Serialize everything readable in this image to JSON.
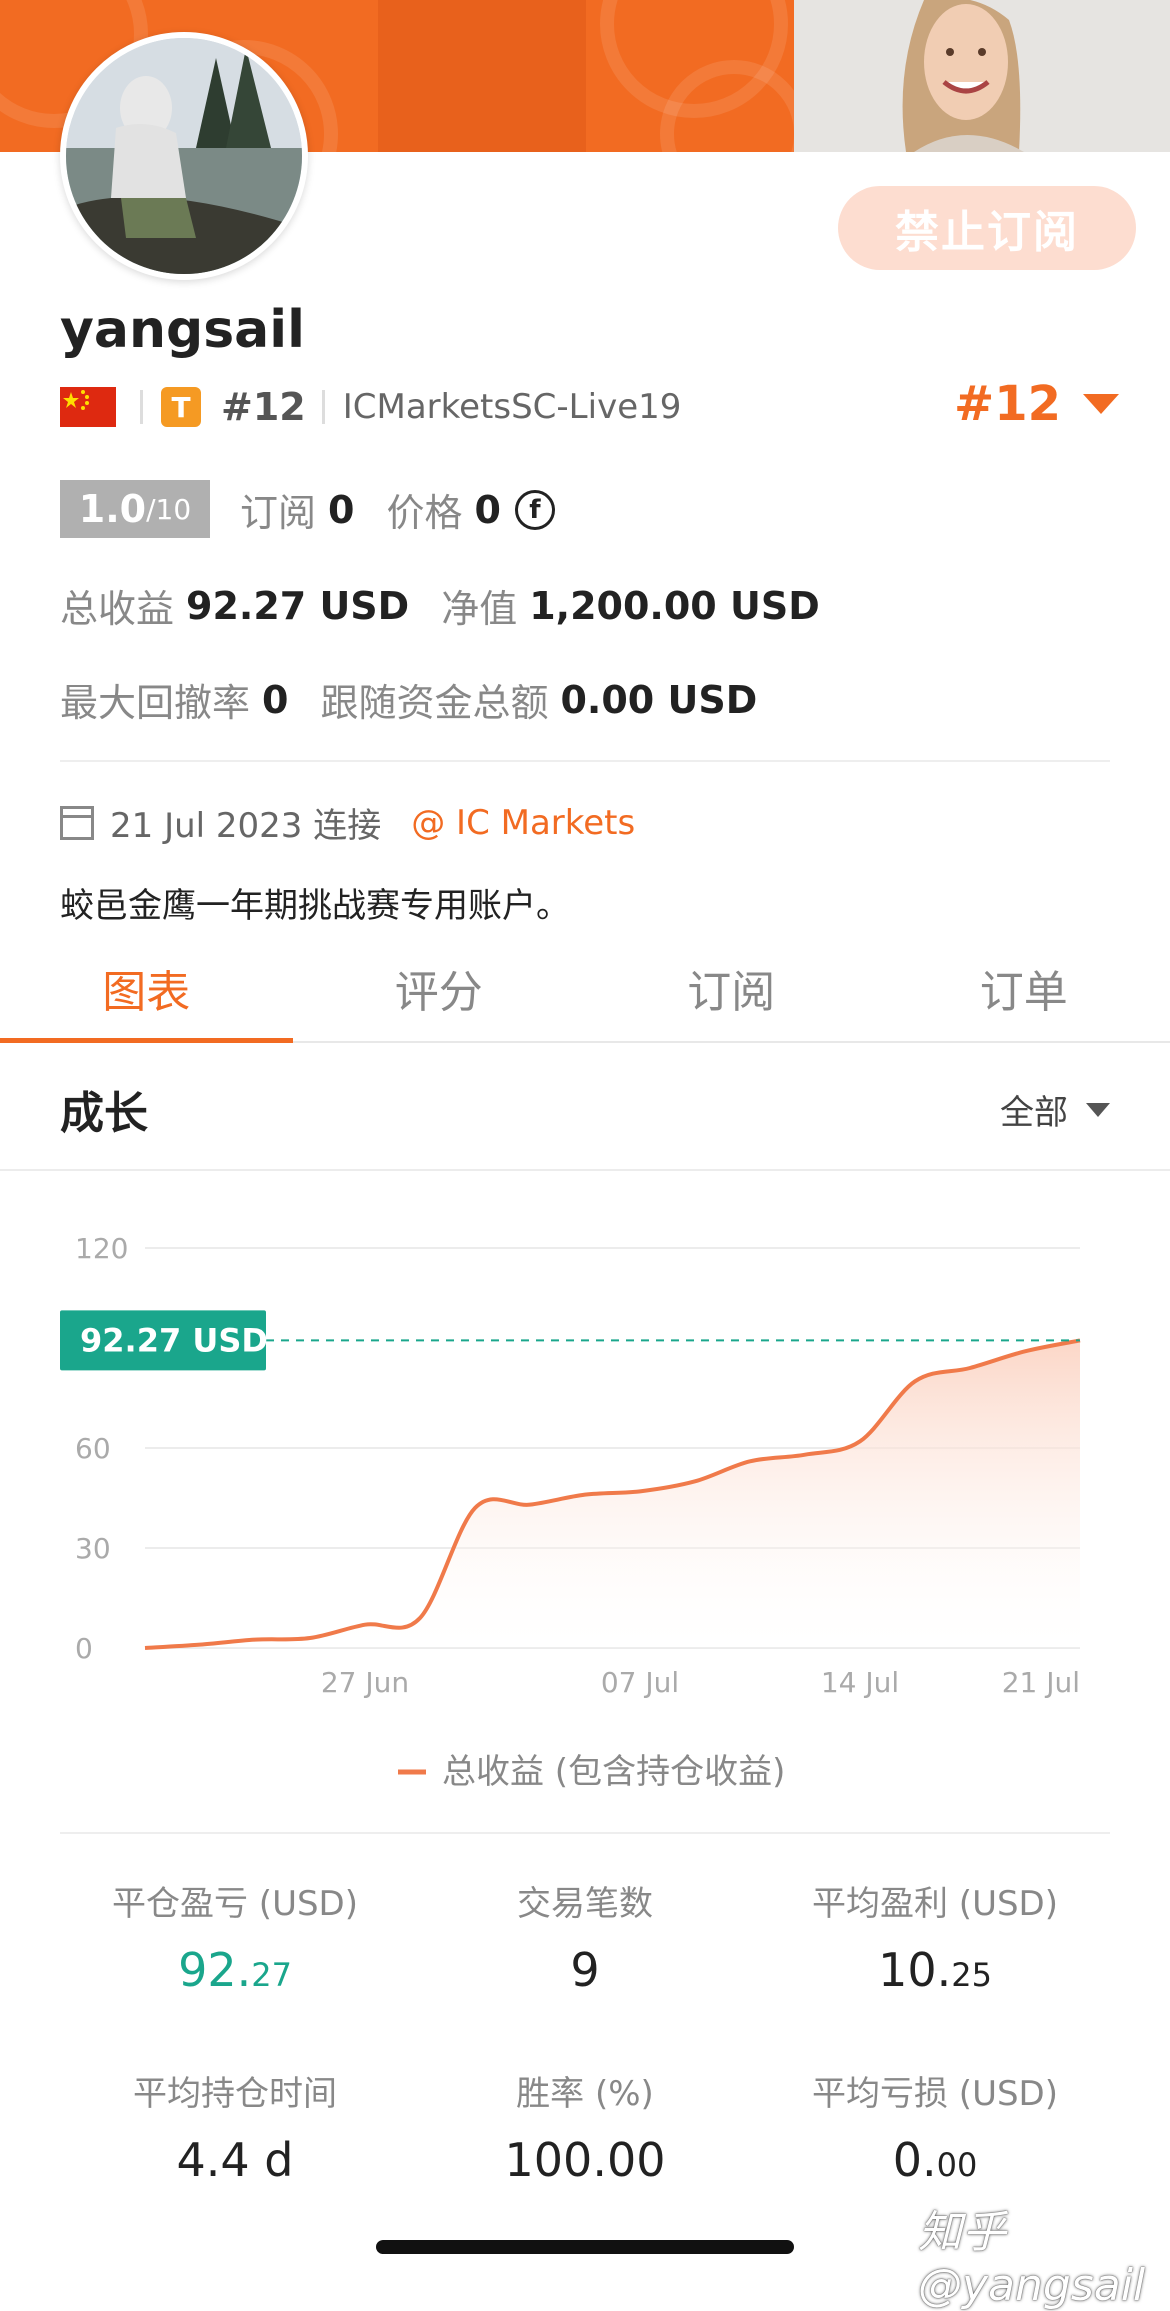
{
  "header": {
    "ban_button": "禁止订阅"
  },
  "profile": {
    "username": "yangsail",
    "tier_letter": "T",
    "rank_small": "#12",
    "server": "ICMarketsSC-Live19",
    "rank_big": "#12",
    "score": "1.0",
    "score_max": "/10",
    "subscribe_label": "订阅",
    "subscribe_value": "0",
    "price_label": "价格",
    "price_value": "0",
    "coin_symbol": "f",
    "total_profit_label": "总收益",
    "total_profit_value": "92.27 USD",
    "equity_label": "净值",
    "equity_value": "1,200.00 USD",
    "max_drawdown_label": "最大回撤率",
    "max_drawdown_value": "0",
    "follow_funds_label": "跟随资金总额",
    "follow_funds_value": "0.00 USD",
    "connected_date": "21 Jul 2023 连接",
    "broker": "@ IC Markets",
    "description": "蛟邑金鹰一年期挑战赛专用账户。"
  },
  "tabs": [
    {
      "label": "图表",
      "active": true
    },
    {
      "label": "评分",
      "active": false
    },
    {
      "label": "订阅",
      "active": false
    },
    {
      "label": "订单",
      "active": false
    }
  ],
  "growth": {
    "title": "成长",
    "range": "全部"
  },
  "chart_data": {
    "type": "area",
    "y_ticks": [
      "120",
      "60",
      "30",
      "0"
    ],
    "x_ticks": [
      "27 Jun",
      "07 Jul",
      "14 Jul",
      "21 Jul"
    ],
    "ylim": [
      0,
      120
    ],
    "current_label": "92.27 USD",
    "current_value": 92.27,
    "legend": "总收益 (包含持仓收益)",
    "series": [
      {
        "name": "总收益 (包含持仓收益)",
        "x": [
          "19 Jun",
          "21 Jun",
          "23 Jun",
          "25 Jun",
          "27 Jun",
          "29 Jun",
          "01 Jul",
          "03 Jul",
          "05 Jul",
          "07 Jul",
          "09 Jul",
          "11 Jul",
          "13 Jul",
          "14 Jul",
          "16 Jul",
          "18 Jul",
          "20 Jul",
          "21 Jul"
        ],
        "values": [
          0,
          1,
          2.5,
          3,
          7,
          9,
          42,
          43,
          46,
          47,
          50,
          56,
          58,
          62,
          80,
          84,
          89,
          92.27
        ]
      }
    ],
    "colors": {
      "line": "#f07a4a",
      "fill_top": "#fbd2c1",
      "marker": "#1aa68c",
      "grid": "#ececec"
    }
  },
  "metrics": [
    {
      "label": "平仓盈亏 (USD)",
      "int": "92.",
      "dec": "27",
      "green": true
    },
    {
      "label": "交易笔数",
      "int": "9",
      "dec": "",
      "green": false
    },
    {
      "label": "平均盈利 (USD)",
      "int": "10.",
      "dec": "25",
      "green": false
    },
    {
      "label": "平均持仓时间",
      "int": "4.4 d",
      "dec": "",
      "green": false
    },
    {
      "label": "胜率 (%)",
      "int": "100.00",
      "dec": "",
      "green": false
    },
    {
      "label": "平均亏损 (USD)",
      "int": "0.",
      "dec": "00",
      "green": false
    }
  ],
  "watermark": "知乎 @yangsail"
}
